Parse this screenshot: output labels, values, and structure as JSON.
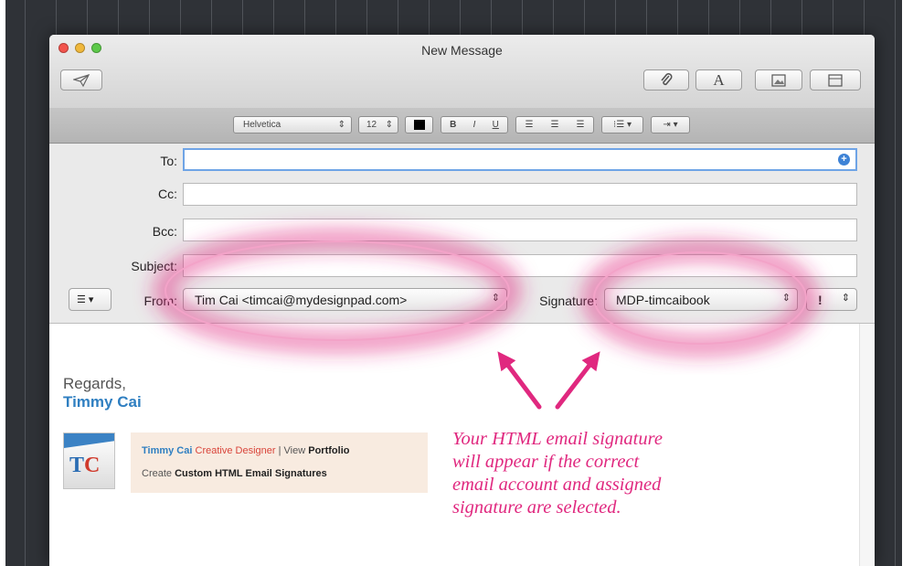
{
  "window": {
    "title": "New Message"
  },
  "toolbar": {
    "send_icon": "paper-plane-icon",
    "attach_icon": "paperclip-icon",
    "fonts_icon": "letter-a-icon",
    "photo_browser_icon": "photo-icon",
    "stationery_icon": "stationery-icon"
  },
  "format_bar": {
    "font": "Helvetica",
    "size": "12",
    "text_color": "#000000",
    "styles": [
      "B",
      "I",
      "U"
    ],
    "alignment": [
      "align-left",
      "align-center",
      "align-right"
    ],
    "list": "list-icon",
    "indent": "indent-icon"
  },
  "fields": {
    "to_label": "To:",
    "cc_label": "Cc:",
    "bcc_label": "Bcc:",
    "subject_label": "Subject:",
    "from_label": "From:",
    "from_value": "Tim Cai <timcai@mydesignpad.com>",
    "signature_label": "Signature:",
    "signature_value": "MDP-timcaibook",
    "priority_value": "!"
  },
  "body": {
    "regards": "Regards,",
    "name": "Timmy Cai",
    "logo_text_t": "T",
    "logo_text_c": "C",
    "sig_line1": {
      "name": "Timmy Cai",
      "role": "Creative Designer",
      "separator": "|",
      "view": "View",
      "portfolio": "Portfolio"
    },
    "sig_line2": {
      "create": "Create",
      "custom": "Custom HTML Email Signatures"
    }
  },
  "annotation": {
    "lines": [
      "Your HTML email signature",
      "will appear if the correct",
      "email account and assigned",
      "signature are selected."
    ]
  },
  "colors": {
    "annotation": "#e0287f",
    "name_blue": "#2f7fc1",
    "role_red": "#d9443a",
    "focus_ring": "#6fa4e6"
  }
}
